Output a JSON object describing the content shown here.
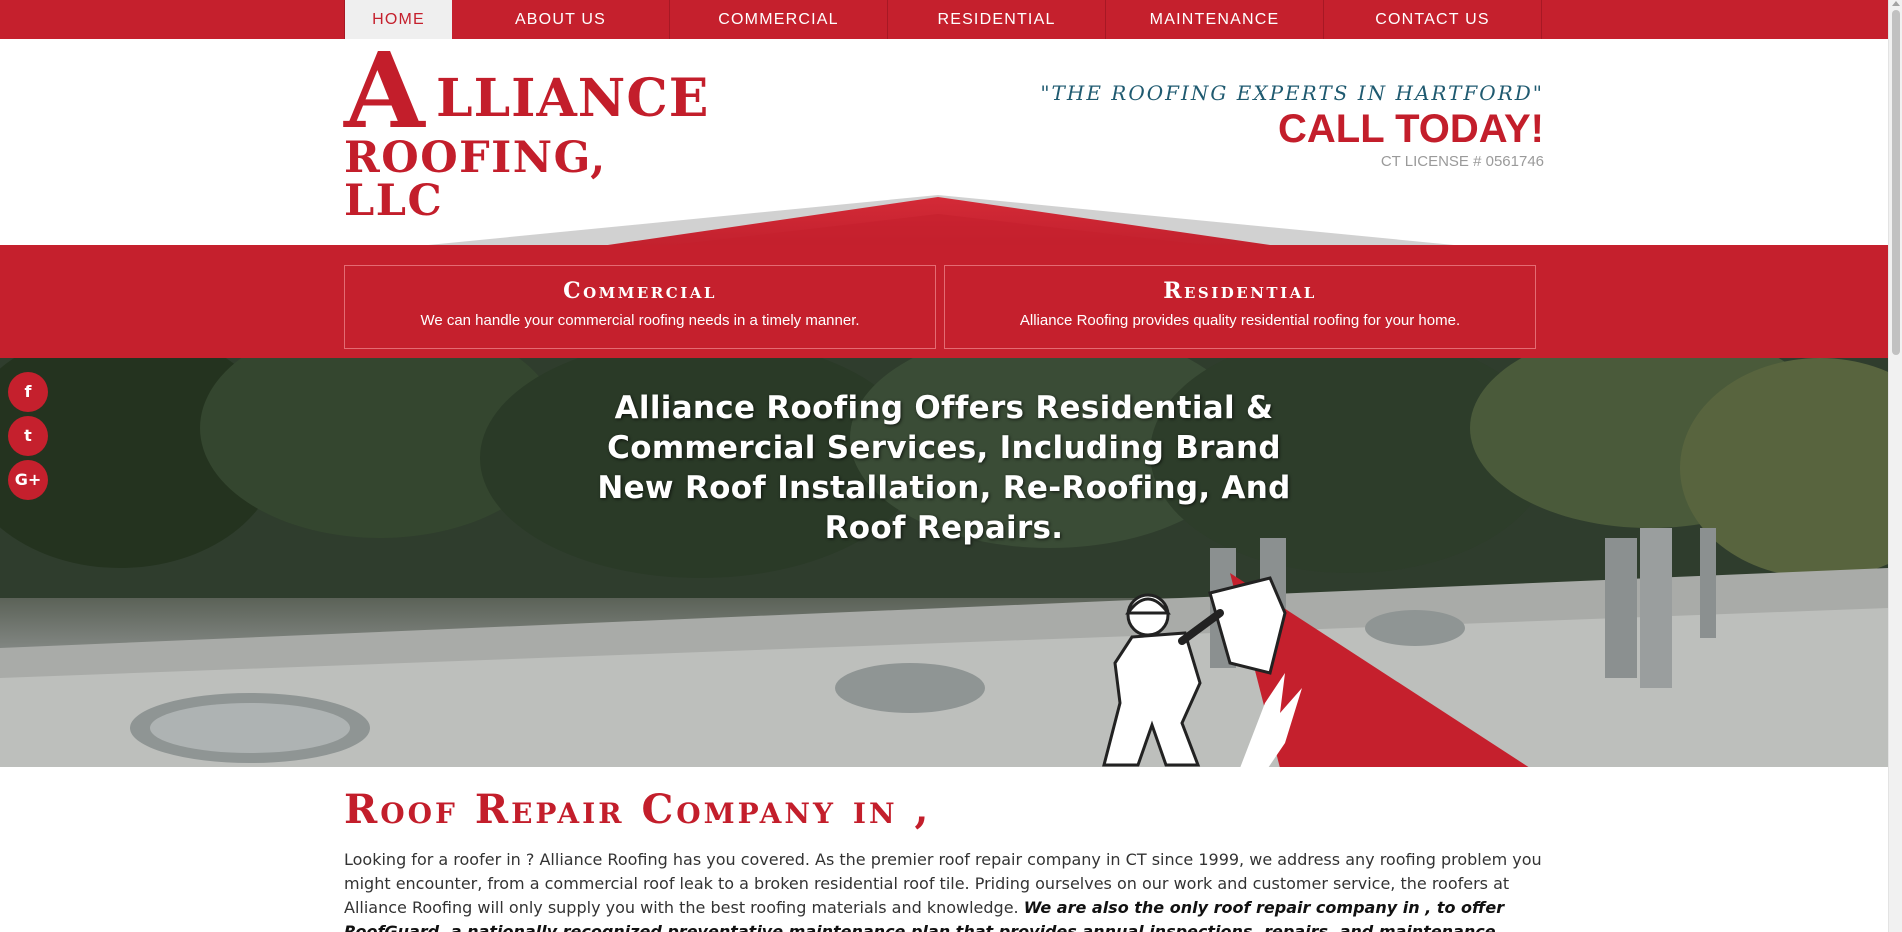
{
  "nav": {
    "items": [
      {
        "label": "HOME",
        "active": true
      },
      {
        "label": "ABOUT US",
        "active": false
      },
      {
        "label": "COMMERCIAL",
        "active": false
      },
      {
        "label": "RESIDENTIAL",
        "active": false
      },
      {
        "label": "MAINTENANCE",
        "active": false
      },
      {
        "label": "CONTACT US",
        "active": false
      }
    ]
  },
  "logo": {
    "letter": "A",
    "rest": "LLIANCE",
    "line2": "ROOFING, LLC"
  },
  "header": {
    "tagline": "\"THE ROOFING EXPERTS IN HARTFORD\"",
    "call": "CALL TODAY!",
    "license": "CT LICENSE # 0561746"
  },
  "services": [
    {
      "title": "Commercial",
      "desc": "We can handle your commercial roofing needs in a timely manner."
    },
    {
      "title": "Residential",
      "desc": "Alliance Roofing provides quality residential roofing for your home."
    }
  ],
  "hero": {
    "headline": "Alliance Roofing Offers Residential & Commercial Services, Including Brand New Roof Installation, Re-Roofing, And Roof Repairs."
  },
  "social": [
    {
      "icon": "facebook-icon",
      "glyph": "f"
    },
    {
      "icon": "twitter-icon",
      "glyph": "t"
    },
    {
      "icon": "google-plus-icon",
      "glyph": "G+"
    }
  ],
  "content": {
    "heading": "Roof Repair Company in ,",
    "body": "Looking for a roofer in ? Alliance Roofing has you covered. As the premier roof repair company in CT since 1999, we address any roofing problem you might encounter, from a commercial roof leak to a broken residential roof tile.  Priding ourselves on our work and customer service, the roofers at Alliance Roofing will only supply you with the best roofing materials and knowledge.",
    "emphasis": "We are also the only roof repair company in , to offer RoofGuard, a nationally recognized preventative maintenance plan that provides annual inspections, repairs, and maintenance under its insured policy."
  },
  "colors": {
    "brand_red": "#c5202d",
    "tagline_teal": "#1f5a70"
  }
}
